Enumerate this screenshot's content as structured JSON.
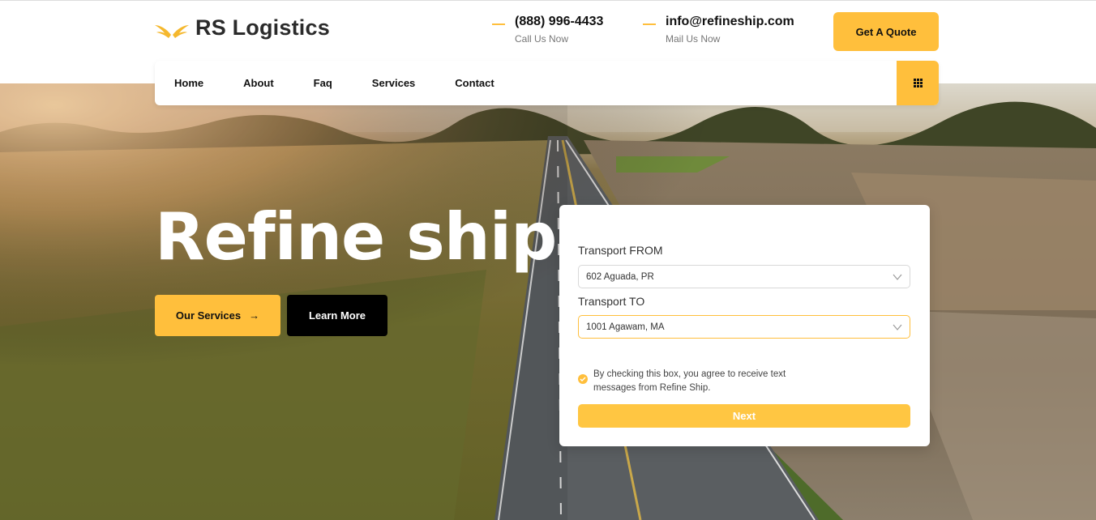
{
  "brand": {
    "name": "RS Logistics",
    "icon": "wings-logo-icon",
    "accent_color": "#ffbf3c"
  },
  "contact": {
    "phone": "(888) 996-4433",
    "phone_caption": "Call Us Now",
    "email": "info@refineship.com",
    "email_caption": "Mail Us Now"
  },
  "header": {
    "quote_label": "Get A Quote"
  },
  "nav": {
    "items": [
      {
        "label": "Home"
      },
      {
        "label": "About"
      },
      {
        "label": "Faq"
      },
      {
        "label": "Services"
      },
      {
        "label": "Contact"
      }
    ],
    "menu_icon": "grid-icon"
  },
  "hero": {
    "title": "Refine ship",
    "primary_button": "Our Services",
    "primary_button_icon": "→",
    "secondary_button": "Learn More"
  },
  "quote_form": {
    "from_label": "Transport FROM",
    "from_value": "602 Aguada, PR",
    "to_label": "Transport TO",
    "to_value": "1001 Agawam, MA",
    "consent_text": "By checking this box, you agree to receive text messages from Refine Ship.",
    "consent_checked": true,
    "submit_label": "Next"
  }
}
